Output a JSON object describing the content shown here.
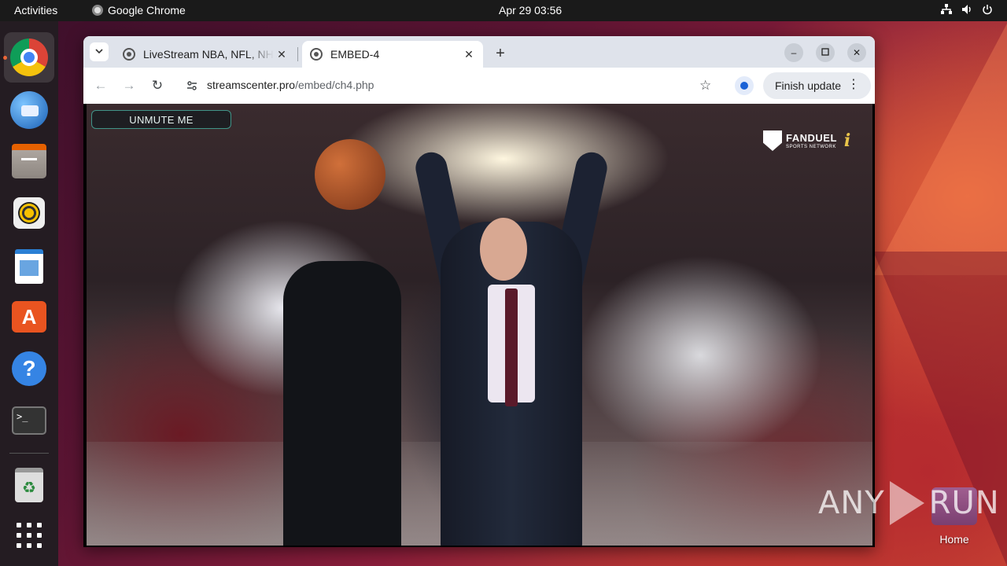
{
  "topbar": {
    "activities": "Activities",
    "app_name": "Google Chrome",
    "clock": "Apr 29  03:56",
    "tray_icons": [
      "network-icon",
      "volume-icon",
      "power-icon"
    ]
  },
  "dock": {
    "items": [
      {
        "name": "Google Chrome",
        "icon": "chrome-icon",
        "active": true
      },
      {
        "name": "Thunderbird",
        "icon": "thunderbird-icon"
      },
      {
        "name": "Files",
        "icon": "files-icon"
      },
      {
        "name": "Rhythmbox",
        "icon": "rhythmbox-icon"
      },
      {
        "name": "LibreOffice Writer",
        "icon": "writer-icon"
      },
      {
        "name": "Ubuntu Software",
        "icon": "software-store-icon"
      },
      {
        "name": "Help",
        "icon": "help-icon"
      },
      {
        "name": "Terminal",
        "icon": "terminal-icon"
      },
      {
        "name": "Trash",
        "icon": "trash-icon"
      },
      {
        "name": "Show Applications",
        "icon": "app-grid-icon"
      }
    ],
    "help_glyph": "?",
    "store_glyph": "A",
    "terminal_glyph": ">_",
    "trash_glyph": "♻"
  },
  "browser": {
    "tabs": [
      {
        "title": "LiveStream NBA, NFL, NHL",
        "active": false
      },
      {
        "title": "EMBED-4",
        "active": true
      }
    ],
    "url_domain": "streamscenter.pro",
    "url_path": "/embed/ch4.php",
    "finish_update": "Finish update"
  },
  "video": {
    "unmute_label": "UNMUTE ME",
    "network_name": "FANDUEL",
    "network_subtitle": "SPORTS NETWORK",
    "network_glyph": "i"
  },
  "desktop": {
    "watermark_left": "ANY",
    "watermark_right": "RUN",
    "home_label": "Home"
  },
  "colors": {
    "accent": "#e95420",
    "topbar_bg": "#1a1a1a",
    "dock_bg": "#241c22",
    "tabstrip_bg": "#dfe3eb",
    "unmute_border": "#50c8b4"
  }
}
